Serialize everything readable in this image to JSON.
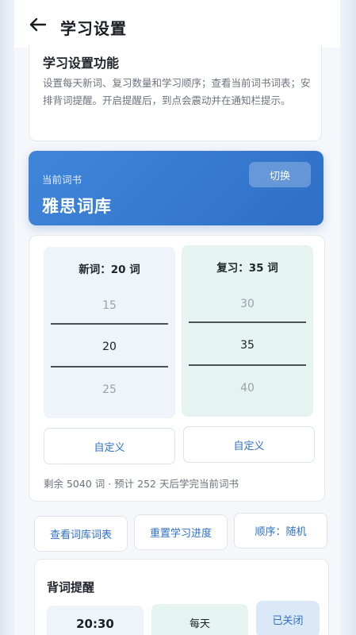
{
  "header": {
    "title": "学习设置"
  },
  "info": {
    "title": "学习设置功能",
    "text": "设置每天新词、复习数量和学习顺序；查看当前词书词表；安排背词提醒。开启提醒后，到点会震动并在通知栏提示。"
  },
  "book": {
    "label": "当前词书",
    "name": "雅思词库",
    "switch_label": "切换"
  },
  "picker": {
    "new": {
      "heading": "新词：20 词",
      "prev": "15",
      "current": "20",
      "next": "25"
    },
    "review": {
      "heading": "复习：35 词",
      "prev": "30",
      "current": "35",
      "next": "40"
    },
    "custom_label": "自定义",
    "remaining": "剩余 5040 词 · 预计 252 天后学完当前词书"
  },
  "actions": {
    "view_list": "查看词库词表",
    "reset": "重置学习进度",
    "order": "顺序：随机"
  },
  "reminder": {
    "title": "背词提醒",
    "time": "20:30",
    "frequency": "每天",
    "status": "已关闭"
  },
  "colors": {
    "accent": "#2f70c6",
    "banner": "#3f86db",
    "review_bg": "#e6f4f1",
    "new_bg": "#eff3fa"
  }
}
